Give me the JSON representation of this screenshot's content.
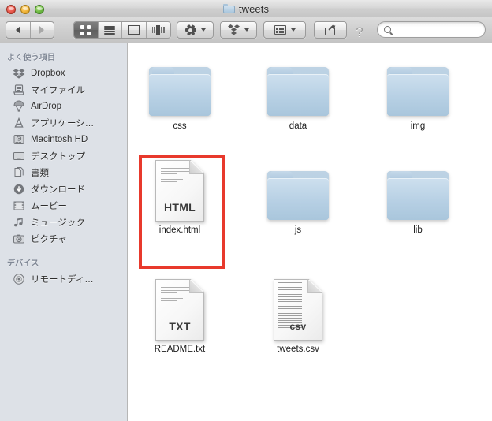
{
  "window": {
    "title": "tweets",
    "title_icon": "folder-icon",
    "traffic_lights": [
      {
        "name": "close-button",
        "color": "#ef6155"
      },
      {
        "name": "minimize-button",
        "color": "#f6bb42"
      },
      {
        "name": "maximize-button",
        "color": "#77c14a"
      }
    ]
  },
  "toolbar": {
    "back_label": "◀",
    "forward_label": "▶",
    "view_modes": [
      {
        "name": "icon-view",
        "icon": "grid-icon",
        "active": true
      },
      {
        "name": "list-view",
        "icon": "list-icon",
        "active": false
      },
      {
        "name": "column-view",
        "icon": "columns-icon",
        "active": false
      },
      {
        "name": "coverflow-view",
        "icon": "coverflow-icon",
        "active": false
      }
    ],
    "action_button": {
      "name": "action-gear-button",
      "icon": "gear-icon"
    },
    "dropbox_button": {
      "name": "dropbox-button",
      "icon": "dropbox-icon"
    },
    "arrange_button": {
      "name": "arrange-button",
      "icon": "arrange-grid-icon"
    },
    "share_button": {
      "name": "share-button",
      "icon": "share-icon"
    },
    "help_label": "?",
    "search": {
      "value": "",
      "placeholder": "",
      "icon": "search-icon"
    }
  },
  "sidebar": {
    "sections": [
      {
        "header": "よく使う項目",
        "items": [
          {
            "label": "Dropbox",
            "icon": "dropbox-icon"
          },
          {
            "label": "マイファイル",
            "icon": "myfiles-icon"
          },
          {
            "label": "AirDrop",
            "icon": "airdrop-icon"
          },
          {
            "label": "アプリケーシ…",
            "icon": "applications-icon"
          },
          {
            "label": "Macintosh HD",
            "icon": "harddisk-icon"
          },
          {
            "label": "デスクトップ",
            "icon": "desktop-icon"
          },
          {
            "label": "書類",
            "icon": "documents-icon"
          },
          {
            "label": "ダウンロード",
            "icon": "downloads-icon"
          },
          {
            "label": "ムービー",
            "icon": "movies-icon"
          },
          {
            "label": "ミュージック",
            "icon": "music-icon"
          },
          {
            "label": "ピクチャ",
            "icon": "pictures-icon"
          }
        ]
      },
      {
        "header": "デバイス",
        "items": [
          {
            "label": "リモートディ…",
            "icon": "remotedisc-icon"
          }
        ]
      }
    ]
  },
  "files": [
    {
      "name": "css",
      "type": "folder",
      "kind": "",
      "col": 0,
      "row": 0,
      "selected": false
    },
    {
      "name": "data",
      "type": "folder",
      "kind": "",
      "col": 1,
      "row": 0,
      "selected": false
    },
    {
      "name": "img",
      "type": "folder",
      "kind": "",
      "col": 2,
      "row": 0,
      "selected": false
    },
    {
      "name": "index.html",
      "type": "document",
      "kind": "HTML",
      "col": 0,
      "row": 1,
      "selected": true
    },
    {
      "name": "js",
      "type": "folder",
      "kind": "",
      "col": 1,
      "row": 1,
      "selected": false
    },
    {
      "name": "lib",
      "type": "folder",
      "kind": "",
      "col": 2,
      "row": 1,
      "selected": false
    },
    {
      "name": "README.txt",
      "type": "document",
      "kind": "TXT",
      "col": 0,
      "row": 2,
      "selected": false
    },
    {
      "name": "tweets.csv",
      "type": "document",
      "kind": "csv",
      "col": 1,
      "row": 2,
      "selected": false
    }
  ],
  "annotation": {
    "name": "red-highlight-box",
    "color": "#e8392c",
    "target": "index.html"
  }
}
